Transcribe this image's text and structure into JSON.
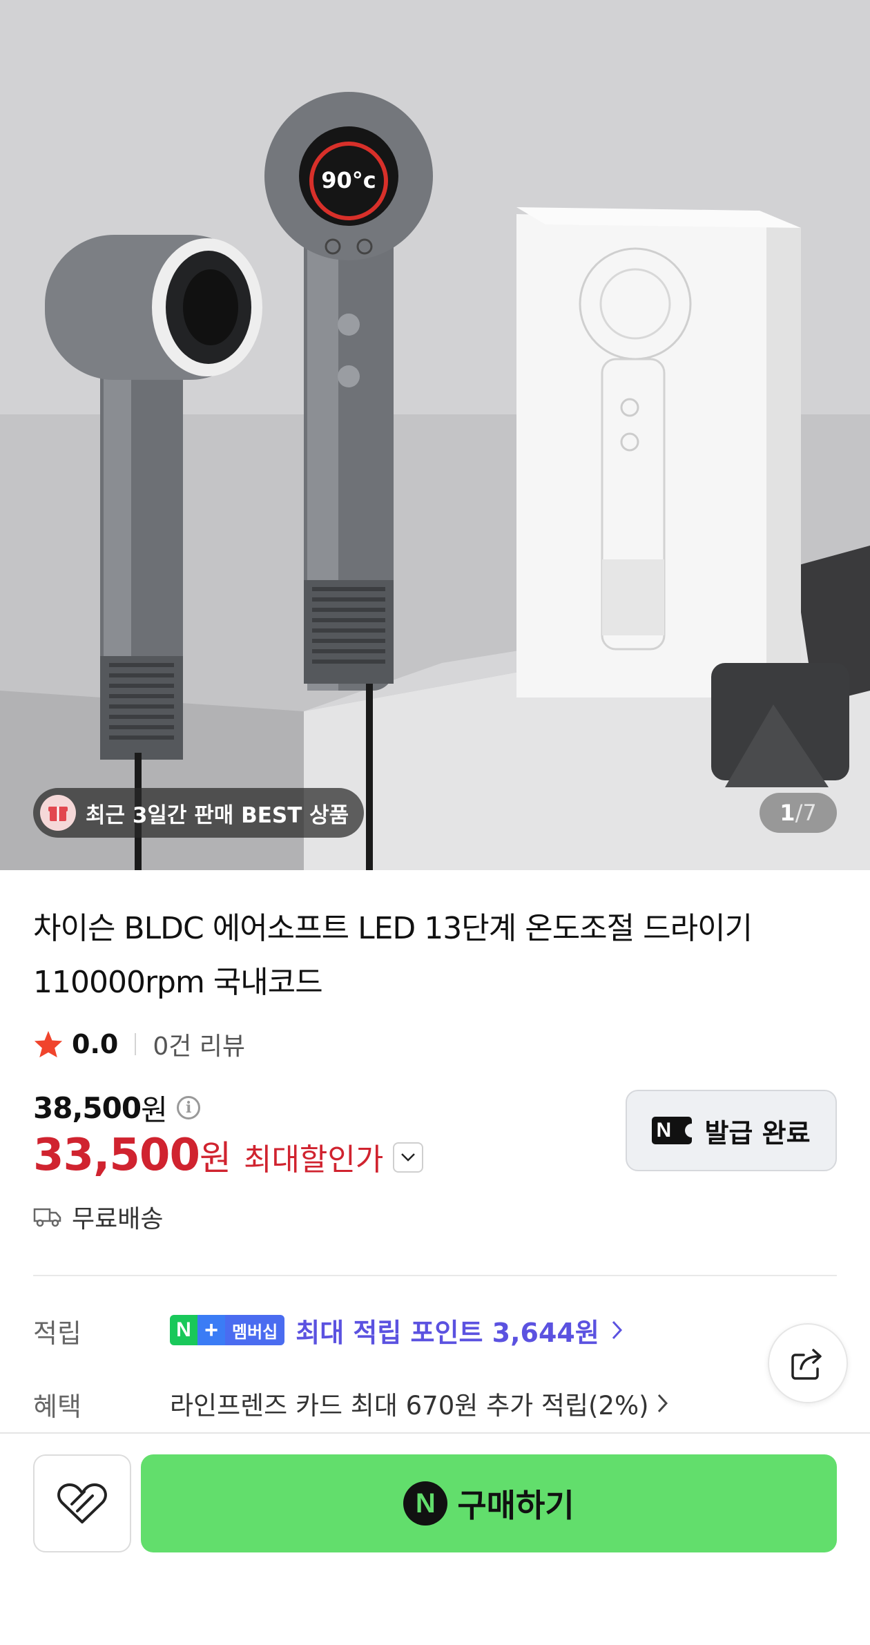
{
  "hero": {
    "badge_text": "최근 3일간 판매 BEST 상품",
    "counter_current": "1",
    "counter_separator": "/",
    "counter_total": "7",
    "display_temp": "90°c"
  },
  "product": {
    "title": "차이슨 BLDC 에어소프트 LED 13단계 온도조절 드라이기 110000rpm 국내코드",
    "rating": "0.0",
    "review_count": "0건 리뷰",
    "original_price": "38,500",
    "original_price_unit": "원",
    "sale_price": "33,500",
    "sale_price_unit": "원",
    "sale_label": "최대할인가",
    "coupon_icon_text": "N",
    "coupon_label": "발급 완료",
    "shipping": "무료배송"
  },
  "rewards": {
    "points_label": "적립",
    "membership_n": "N",
    "membership_plus": "+",
    "membership_text": "멤버십",
    "points_text": "최대 적립 포인트 3,644원",
    "benefit_label": "혜택",
    "benefit_text": "라인프렌즈 카드 최대 670원 추가 적립(2%)"
  },
  "actions": {
    "buy_icon_text": "N",
    "buy_label": "구매하기"
  },
  "colors": {
    "sale_red": "#d0232f",
    "points_purple": "#5b52e0",
    "buy_green": "#62de6c",
    "star": "#f0442c"
  },
  "icons": [
    "gift-icon",
    "star-icon",
    "info-icon",
    "chevron-down-icon",
    "truck-icon",
    "chevron-right-icon",
    "share-icon",
    "heart-icon",
    "naver-pay-icon"
  ]
}
